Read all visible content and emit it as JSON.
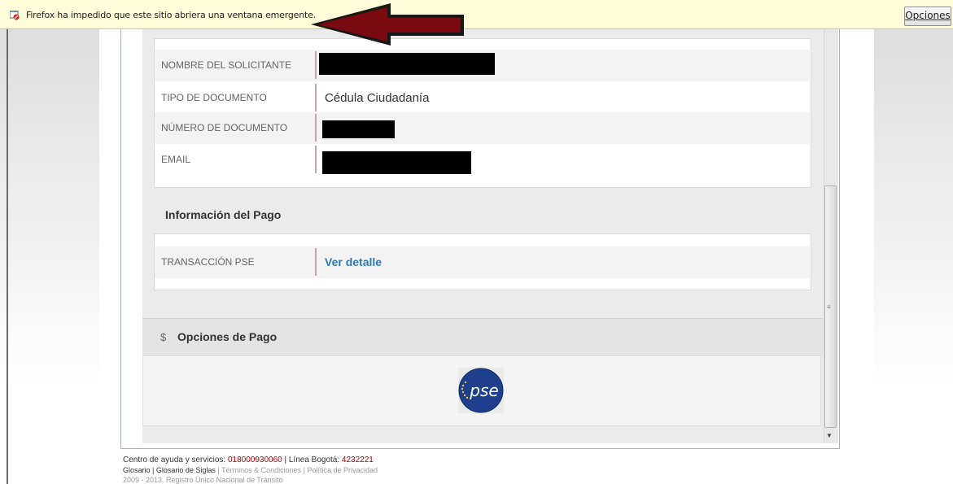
{
  "notification": {
    "message": "Firefox ha impedido que este sitio abriera una ventana emergente.",
    "options_button": "Opciones"
  },
  "applicant": {
    "rows": [
      {
        "label": "NOMBRE DEL SOLICITANTE",
        "value": ""
      },
      {
        "label": "TIPO DE DOCUMENTO",
        "value": "Cédula Ciudadanía"
      },
      {
        "label": "NÚMERO DE DOCUMENTO",
        "value": ""
      },
      {
        "label": "EMAIL",
        "value": ""
      }
    ]
  },
  "payment_info": {
    "title": "Información del Pago",
    "row_label": "TRANSACCIÓN PSE",
    "row_link": "Ver detalle"
  },
  "payment_options": {
    "icon": "$",
    "title": "Opciones de Pago",
    "logo_text": "pse"
  },
  "footer": {
    "help_text": "Centro de ayuda y servicios: ",
    "help_phone": "018000930060",
    "bogota_text": " | Línea Bogotá: ",
    "bogota_phone": "4232221",
    "glossary": "Glosario",
    "glossary_sep": " | ",
    "glossary_acronyms": "Glosario de Siglas",
    "sep2": " | ",
    "terms": "Términos & Condiciones",
    "sep3": " | ",
    "privacy": "Política de Privacidad",
    "copyright": "2009 - 2013. Registro Único Nacional de Tránsito"
  },
  "colors": {
    "link": "#2a7ab9",
    "phone": "#b00000",
    "arrow": "#7a0a10"
  }
}
